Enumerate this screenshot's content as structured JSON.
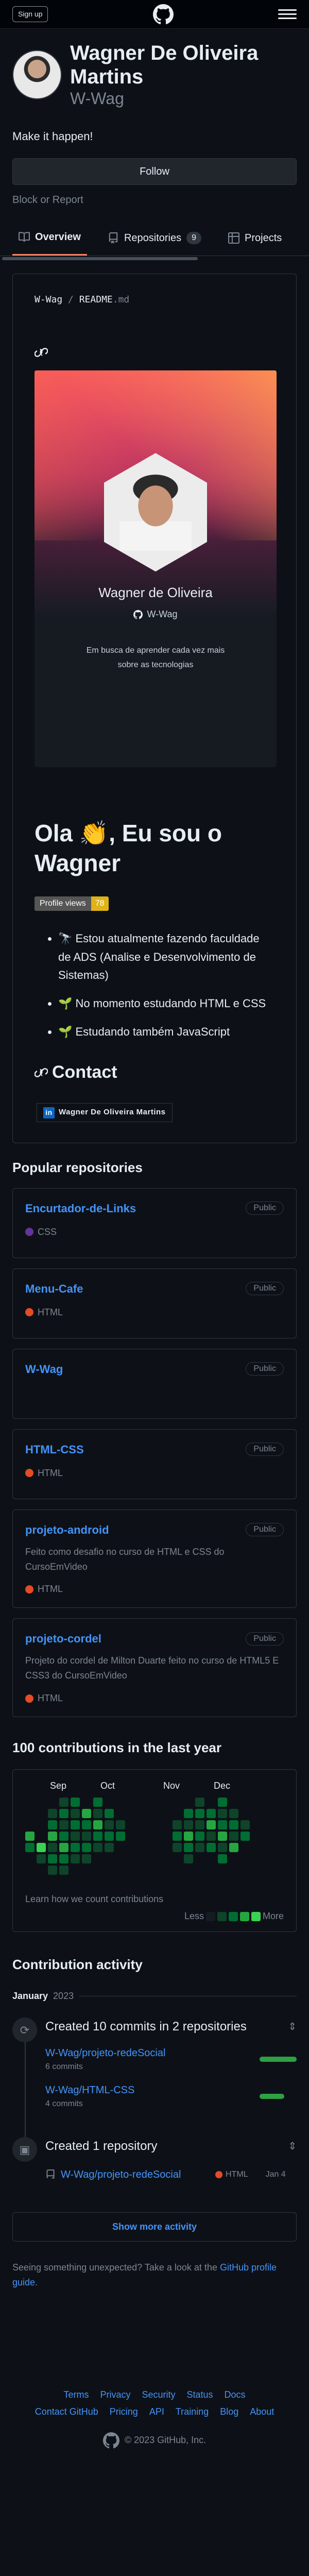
{
  "header": {
    "signup_label": "Sign up",
    "logo_icon": "github-mark-icon",
    "menu_icon": "hamburger-icon"
  },
  "profile": {
    "name": "Wagner De Oliveira Martins",
    "login": "W-Wag",
    "bio": "Make it happen!",
    "follow_label": "Follow",
    "block_report_label": "Block or Report"
  },
  "tabs": [
    {
      "label": "Overview",
      "icon": "book-icon",
      "active": true
    },
    {
      "label": "Repositories",
      "icon": "repo-icon",
      "count": "9"
    },
    {
      "label": "Projects",
      "icon": "table-icon"
    }
  ],
  "readme": {
    "owner": "W-Wag",
    "separator": "/",
    "file": "README",
    "ext": ".md",
    "card": {
      "name": "Wagner de Oliveira",
      "login": "W-Wag",
      "description": "Em busca de aprender cada vez mais sobre as tecnologias"
    },
    "heading": "Ola 👏, Eu sou o Wagner",
    "profile_views_label": "Profile views",
    "profile_views_count": "78",
    "items": [
      "🔭 Estou atualmente fazendo faculdade de ADS (Analise e Desenvolvimento de Sistemas)",
      "🌱 No momento estudando HTML e CSS",
      "🌱 Estudando também JavaScript"
    ],
    "contact_heading": "Contact",
    "linkedin_label": "Wagner De Oliveira Martins"
  },
  "popular": {
    "title": "Popular repositories",
    "repos": [
      {
        "name": "Encurtador-de-Links",
        "visibility": "Public",
        "description": "",
        "language": "CSS",
        "color": "#663399"
      },
      {
        "name": "Menu-Cafe",
        "visibility": "Public",
        "description": "",
        "language": "HTML",
        "color": "#e34c26"
      },
      {
        "name": "W-Wag",
        "visibility": "Public",
        "description": "",
        "language": "",
        "color": ""
      },
      {
        "name": "HTML-CSS",
        "visibility": "Public",
        "description": "",
        "language": "HTML",
        "color": "#e34c26"
      },
      {
        "name": "projeto-android",
        "visibility": "Public",
        "description": "Feito como desafio no curso de HTML e CSS do CursoEmVideo",
        "language": "HTML",
        "color": "#e34c26"
      },
      {
        "name": "projeto-cordel",
        "visibility": "Public",
        "description": "Projeto do cordel de Milton Duarte feito no curso de HTML5 E CSS3 do CursoEmVideo",
        "language": "HTML",
        "color": "#e34c26"
      }
    ]
  },
  "contributions": {
    "title": "100 contributions in the last year",
    "months": [
      "Sep",
      "Oct",
      "Nov",
      "Dec"
    ],
    "learn_label": "Learn how we count contributions",
    "less_label": "Less",
    "more_label": "More",
    "levels": [
      "#161b22",
      "#0e4429",
      "#006d32",
      "#26a641",
      "#39d353"
    ]
  },
  "activity": {
    "title": "Contribution activity",
    "month": "January",
    "year": "2023",
    "event1": {
      "title": "Created 10 commits in 2 repositories",
      "rows": [
        {
          "repo": "W-Wag/projeto-redeSocial",
          "count": "6 commits",
          "share": 0.6
        },
        {
          "repo": "W-Wag/HTML-CSS",
          "count": "4 commits",
          "share": 0.4
        }
      ]
    },
    "event2": {
      "title": "Created 1 repository",
      "repo": "W-Wag/projeto-redeSocial",
      "language": "HTML",
      "date": "Jan 4"
    },
    "show_more_label": "Show more activity",
    "unexpected_text": "Seeing something unexpected? Take a look at the",
    "guide_link": "GitHub profile guide",
    "unexpected_end": "."
  },
  "footer": {
    "row1": [
      "Terms",
      "Privacy",
      "Security",
      "Status",
      "Docs"
    ],
    "row2": [
      "Contact GitHub",
      "Pricing",
      "API",
      "Training",
      "Blog",
      "About"
    ],
    "copyright": "© 2023 GitHub, Inc."
  }
}
